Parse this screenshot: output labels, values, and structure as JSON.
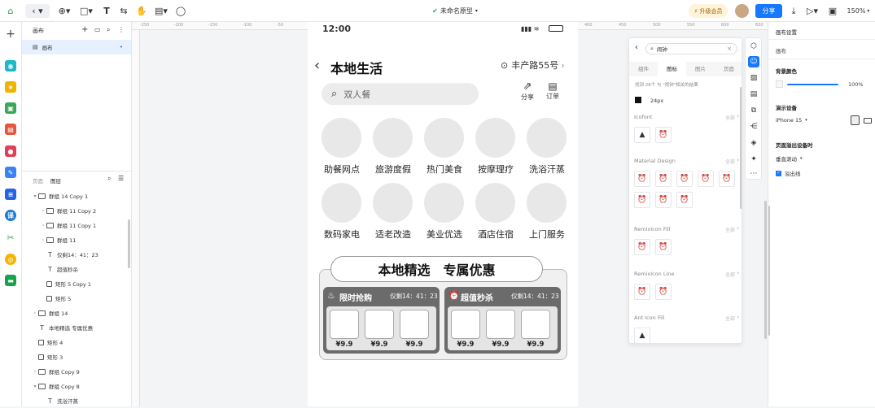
{
  "toolbar": {
    "doc_title": "未命名原型",
    "upgrade": "升级会员",
    "share": "分享",
    "zoom": "150%"
  },
  "left_panel": {
    "top_title": "画布",
    "canvas_item": "画布",
    "tab_pages": "页面",
    "tab_layers": "图层",
    "layers": [
      {
        "label": "群组 14 Copy 1",
        "type": "group",
        "expand": "down"
      },
      {
        "label": "群组 11 Copy 2",
        "type": "group",
        "expand": "right"
      },
      {
        "label": "群组 11 Copy 1",
        "type": "group",
        "expand": "right"
      },
      {
        "label": "群组 11",
        "type": "group",
        "expand": "right"
      },
      {
        "label": "仅剩14：41：23",
        "type": "text",
        "expand": ""
      },
      {
        "label": "超值秒杀",
        "type": "text",
        "expand": ""
      },
      {
        "label": "矩形 5 Copy 1",
        "type": "rect",
        "expand": ""
      },
      {
        "label": "矩形 5",
        "type": "rect",
        "expand": ""
      },
      {
        "label": "群组 14",
        "type": "group",
        "expand": "right"
      },
      {
        "label": "本地精选 专属优惠",
        "type": "text",
        "expand": ""
      },
      {
        "label": "矩形 4",
        "type": "rect",
        "expand": ""
      },
      {
        "label": "矩形 3",
        "type": "rect",
        "expand": ""
      },
      {
        "label": "群组 Copy 9",
        "type": "group",
        "expand": "right"
      },
      {
        "label": "群组 Copy 8",
        "type": "group",
        "expand": "down"
      },
      {
        "label": "洗浴汗蒸",
        "type": "text",
        "expand": ""
      }
    ]
  },
  "ruler": {
    "ticks": [
      "-250",
      "-200",
      "-150",
      "-100",
      "-50",
      "0",
      "50",
      "100",
      "150",
      "200",
      "250",
      "300",
      "350",
      "400",
      "450",
      "500",
      "550",
      "600",
      "650",
      "700",
      "750"
    ]
  },
  "phone": {
    "status_time": "12:00",
    "title": "本地生活",
    "location": "丰产路55号",
    "search_placeholder": "双人餐",
    "share_label": "分享",
    "order_label": "订单",
    "categories": [
      "助餐网点",
      "旅游度假",
      "热门美食",
      "按摩理疗",
      "洗浴汗蒸",
      "数码家电",
      "适老改造",
      "美业优选",
      "酒店住宿",
      "上门服务"
    ],
    "banner": "本地精选　专属优惠",
    "deals": [
      {
        "name": "限时抢购",
        "timer": "仅剩14：41：23",
        "prices": [
          "¥9.9",
          "¥9.9",
          "¥9.9"
        ]
      },
      {
        "name": "超值秒杀",
        "timer": "仅剩14：41：23",
        "prices": [
          "¥9.9",
          "¥9.9",
          "¥9.9"
        ]
      }
    ]
  },
  "icon_panel": {
    "search_value": "闹钟",
    "tabs": [
      "组件",
      "图标",
      "图片",
      "页面"
    ],
    "result_text": "找到 26个 与 \"闹钟\"相关的结果",
    "size_label": "24px",
    "all_label": "全部",
    "sections": [
      "Icofont",
      "Material Design",
      "RemixIcon Fill",
      "RemixIcon Line",
      "Ant Icon Fill"
    ]
  },
  "right_panel": {
    "title": "画布设置",
    "subtitle": "画布",
    "bg_label": "背景颜色",
    "opacity": "100%",
    "device_label": "演示设备",
    "device_value": "iPhone 15",
    "overflow_label": "页面溢出设备时",
    "scroll_value": "垂直滚动",
    "overflow_line": "溢出线"
  },
  "colors": {
    "accent": "#1677ff",
    "upgrade_bg": "#fff4d9"
  }
}
